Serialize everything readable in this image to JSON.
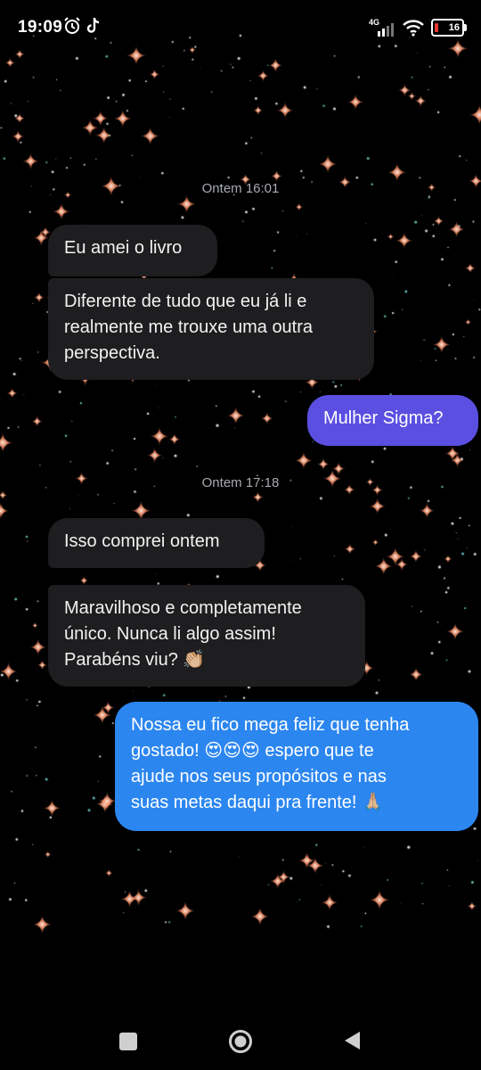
{
  "status_bar": {
    "time": "19:09",
    "network": "4G",
    "battery": "16",
    "icons": [
      "alarm-icon",
      "tiktok-icon",
      "signal-icon",
      "wifi-icon",
      "battery-icon"
    ]
  },
  "conversation": {
    "timestamps": [
      "Ontem 16:01",
      "Ontem 17:18"
    ],
    "messages": [
      {
        "side": "incoming",
        "text": "Eu amei o livro"
      },
      {
        "side": "incoming",
        "text": "Diferente de tudo que eu já li e\nrealmente me trouxe uma outra\nperspectiva."
      },
      {
        "side": "outgoing",
        "text": "Mulher Sigma?"
      },
      {
        "side": "incoming",
        "text": "Isso comprei ontem"
      },
      {
        "side": "incoming",
        "text": "Maravilhoso e completamente\núnico. Nunca li algo assim!\nParabéns viu? 👏🏼"
      },
      {
        "side": "outgoing",
        "text": "Nossa eu fico mega feliz que tenha\ngostado! 😍😍😍 espero que te\najude nos seus propósitos e nas\nsuas metas daqui pra frente! 🙏🏼"
      }
    ]
  },
  "colors": {
    "background": "#000000",
    "incoming_bubble": "#1e1e20",
    "outgoing_purple": "#5a4fe0",
    "outgoing_blue": "#2b86f0",
    "timestamp_text": "#a9a9b2"
  },
  "nav_bar": {
    "buttons": [
      "recents-button",
      "home-button",
      "back-button"
    ]
  }
}
